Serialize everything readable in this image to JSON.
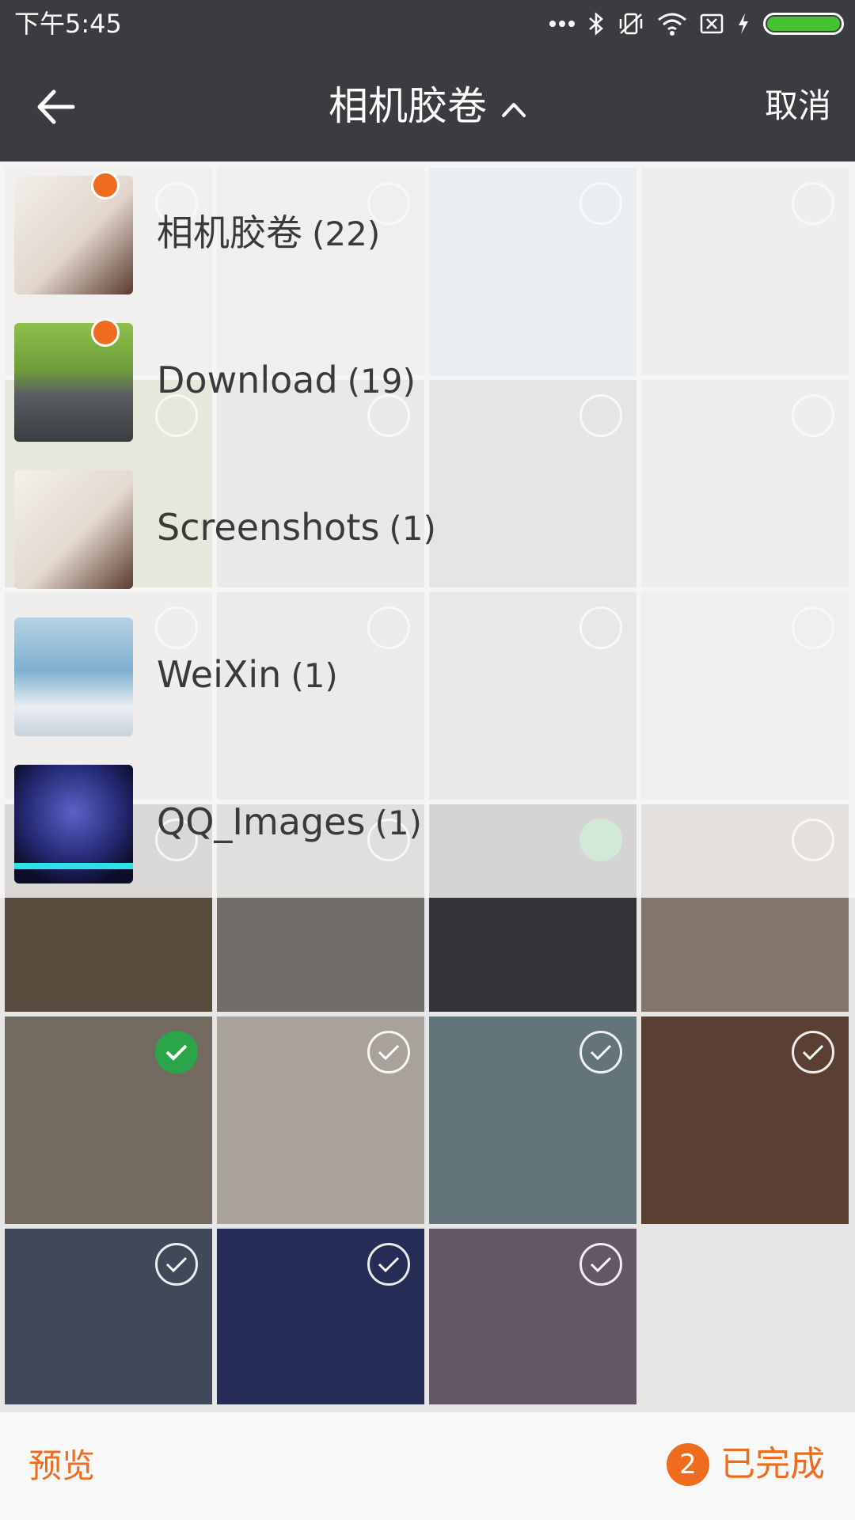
{
  "status_bar": {
    "time": "下午5:45",
    "icons": [
      "more-dots-icon",
      "bluetooth-icon",
      "vibrate-off-icon",
      "wifi-icon",
      "sim-off-icon",
      "charging-icon",
      "battery-icon"
    ],
    "battery_color": "#44c331"
  },
  "app_bar": {
    "title": "相机胶卷",
    "cancel_label": "取消",
    "background": "#3b3c40"
  },
  "albums": [
    {
      "name": "相机胶卷",
      "count": "(22)",
      "selected_dot": true
    },
    {
      "name": "Download",
      "count": "(19)",
      "selected_dot": true
    },
    {
      "name": "Screenshots",
      "count": "(1)",
      "selected_dot": false
    },
    {
      "name": "WeiXin",
      "count": "(1)",
      "selected_dot": false
    },
    {
      "name": "QQ_Images",
      "count": "(1)",
      "selected_dot": false
    }
  ],
  "bottom_bar": {
    "preview_label": "预览",
    "selected_count": "2",
    "done_label": "已完成",
    "accent": "#ef6c1e"
  }
}
